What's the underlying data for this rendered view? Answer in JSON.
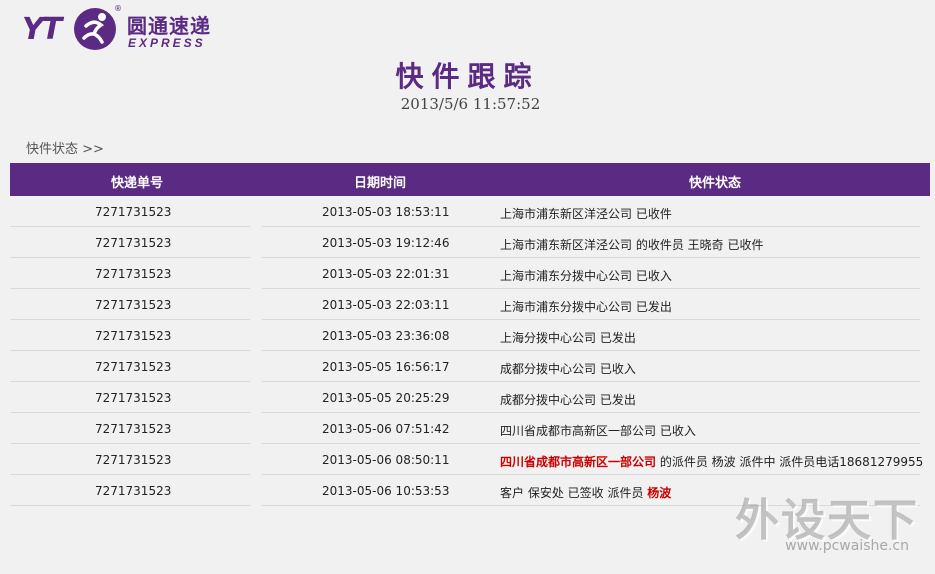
{
  "logo": {
    "brand_mark": "YT",
    "name_cn": "圆通速递",
    "name_en": "EXPRESS",
    "reg": "®"
  },
  "page": {
    "title": "快件跟踪",
    "query_time": "2013/5/6 11:57:52",
    "section_label": "快件状态 >>"
  },
  "table": {
    "headers": {
      "number": "快递单号",
      "time": "日期时间",
      "status": "快件状态"
    },
    "rows": [
      {
        "number": "7271731523",
        "time": "2013-05-03 18:53:11",
        "status": "上海市浦东新区洋泾公司 已收件"
      },
      {
        "number": "7271731523",
        "time": "2013-05-03 19:12:46",
        "status": "上海市浦东新区洋泾公司 的收件员 王晓奇 已收件"
      },
      {
        "number": "7271731523",
        "time": "2013-05-03 22:01:31",
        "status": "上海市浦东分拨中心公司 已收入"
      },
      {
        "number": "7271731523",
        "time": "2013-05-03 22:03:11",
        "status": "上海市浦东分拨中心公司 已发出"
      },
      {
        "number": "7271731523",
        "time": "2013-05-03 23:36:08",
        "status": "上海分拨中心公司 已发出"
      },
      {
        "number": "7271731523",
        "time": "2013-05-05 16:56:17",
        "status": "成都分拨中心公司 已收入"
      },
      {
        "number": "7271731523",
        "time": "2013-05-05 20:25:29",
        "status": "成都分拨中心公司 已发出"
      },
      {
        "number": "7271731523",
        "time": "2013-05-06 07:51:42",
        "status": "四川省成都市高新区一部公司 已收入"
      },
      {
        "number": "7271731523",
        "time": "2013-05-06 08:50:11",
        "status_red": "四川省成都市高新区一部公司",
        "status": " 的派件员 杨波 派件中 派件员电话18681279955"
      },
      {
        "number": "7271731523",
        "time": "2013-05-06 10:53:53",
        "status": "客户 保安处 已签收 派件员 ",
        "status_red_after": "杨波"
      }
    ]
  },
  "watermark": {
    "cn": "外设天下",
    "en": "www.pcwaishe.cn"
  },
  "colors": {
    "brand": "#5b2a83",
    "highlight": "#cc0000",
    "background": "#f1f1f1"
  }
}
